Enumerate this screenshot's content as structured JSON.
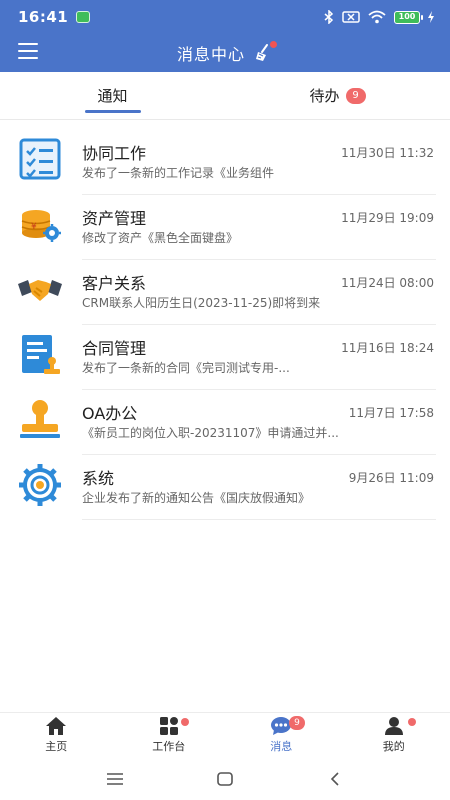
{
  "status_bar": {
    "time": "16:41",
    "battery": "100"
  },
  "header": {
    "title": "消息中心"
  },
  "tabs": [
    {
      "label": "通知",
      "badge": ""
    },
    {
      "label": "待办",
      "badge": "9"
    }
  ],
  "notifications": [
    {
      "icon": "task-checklist-icon",
      "title": "协同工作",
      "time": "11月30日 11:32",
      "preview": "发布了一条新的工作记录《业务组件"
    },
    {
      "icon": "coins-gear-icon",
      "title": "资产管理",
      "time": "11月29日 19:09",
      "preview": "修改了资产《黑色全面键盘》"
    },
    {
      "icon": "handshake-icon",
      "title": "客户关系",
      "time": "11月24日 08:00",
      "preview": "CRM联系人阳历生日(2023-11-25)即将到来"
    },
    {
      "icon": "contract-stamp-icon",
      "title": "合同管理",
      "time": "11月16日 18:24",
      "preview": "发布了一条新的合同《完司测试专用-..."
    },
    {
      "icon": "stamp-icon",
      "title": "OA办公",
      "time": "11月7日 17:58",
      "preview": "《新员工的岗位入职-20231107》申请通过并..."
    },
    {
      "icon": "system-gear-icon",
      "title": "系统",
      "time": "9月26日 11:09",
      "preview": "企业发布了新的通知公告《国庆放假通知》"
    }
  ],
  "bottom_nav": [
    {
      "label": "主页",
      "icon": "home-icon"
    },
    {
      "label": "工作台",
      "icon": "workbench-icon"
    },
    {
      "label": "消息",
      "icon": "message-icon",
      "badge": "9"
    },
    {
      "label": "我的",
      "icon": "profile-icon"
    }
  ],
  "colors": {
    "primary": "#4a74c9",
    "badge": "#f06a6a",
    "orange": "#f5a623",
    "blue": "#2e8ad8"
  }
}
